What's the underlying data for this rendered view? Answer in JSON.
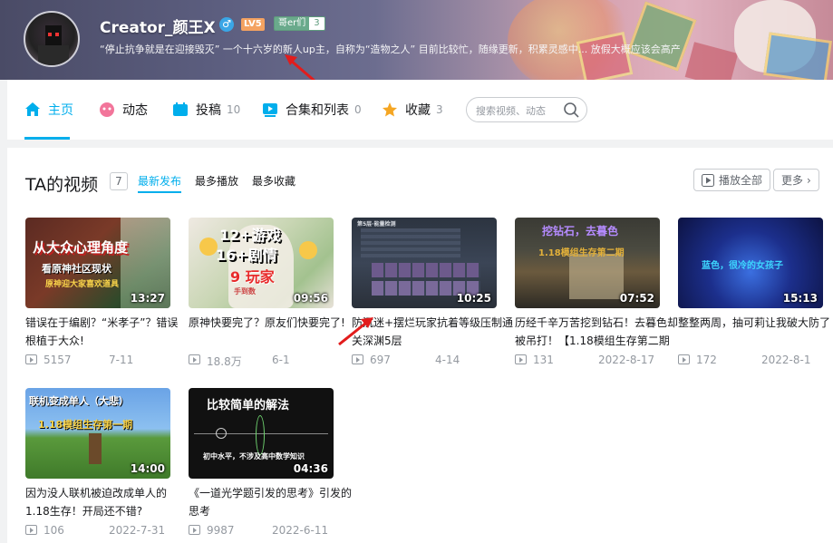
{
  "profile": {
    "name": "Creator_颜王X",
    "gender_symbol": "♂",
    "level": "LV5",
    "medal_name": "哥er们",
    "medal_level": "3",
    "signature": "“停止抗争就是在迎接毁灭” 一个十六岁的新人up主，自称为“造物之人” 目前比较忙，随缘更新，积累灵感中... 放假大概应该会高产"
  },
  "nav": {
    "home": "主页",
    "dynamic": "动态",
    "uploads": "投稿",
    "uploads_count": "10",
    "collections": "合集和列表",
    "collections_count": "0",
    "favorites": "收藏",
    "favorites_count": "3",
    "search_placeholder": "搜索视频、动态"
  },
  "section": {
    "title": "TA的视频",
    "count": "7",
    "sort_latest": "最新发布",
    "sort_most_played": "最多播放",
    "sort_most_fav": "最多收藏",
    "play_all": "播放全部",
    "more": "更多"
  },
  "videos": [
    {
      "duration": "13:27",
      "title": "错误在于编剧？“米孝子”？错误根植于大众!",
      "views": "5157",
      "date": "7-11",
      "thumb_lines": [
        "从大众心理角度",
        "看原神社区现状",
        "原神迎大家喜欢道具"
      ]
    },
    {
      "duration": "09:56",
      "title": "原神快要完了？原友们快要完了!",
      "views": "18.8万",
      "date": "6-1",
      "thumb_lines": [
        "12+游戏",
        "16+剧情",
        "9 玩家",
        "手到数"
      ]
    },
    {
      "duration": "10:25",
      "title": "防沉迷+摆烂玩家抗着等级压制通关深渊5层",
      "views": "697",
      "date": "4-14",
      "thumb_lines": [
        "第5层·能量检测"
      ]
    },
    {
      "duration": "07:52",
      "title": "历经千辛万苦挖到钻石！去暮色却被吊打！【1.18模组生存第二期",
      "views": "131",
      "date": "2022-8-17",
      "thumb_lines": [
        "挖钻石，去暮色",
        "1.18模组生存第二期"
      ]
    },
    {
      "duration": "15:13",
      "title": "整整两周，抽可莉让我破大防了",
      "views": "172",
      "date": "2022-8-1",
      "thumb_lines": [
        "蓝色，很冷的女孩子"
      ]
    },
    {
      "duration": "14:00",
      "title": "因为没人联机被迫改成单人的1.18生存！开局还不错?",
      "views": "106",
      "date": "2022-7-31",
      "thumb_lines": [
        "联机变成单人（大悲）",
        "1.18模组生存第一期"
      ]
    },
    {
      "duration": "04:36",
      "title": "《一道光学题引发的思考》引发的思考",
      "views": "9987",
      "date": "2022-6-11",
      "thumb_lines": [
        "比较简单的解法",
        "初中水平，不涉及高中数学知识"
      ]
    }
  ],
  "colors": {
    "accent": "#00aeec",
    "text": "#18191c",
    "muted": "#9499a0",
    "annotation_arrow": "#e21c1c"
  }
}
